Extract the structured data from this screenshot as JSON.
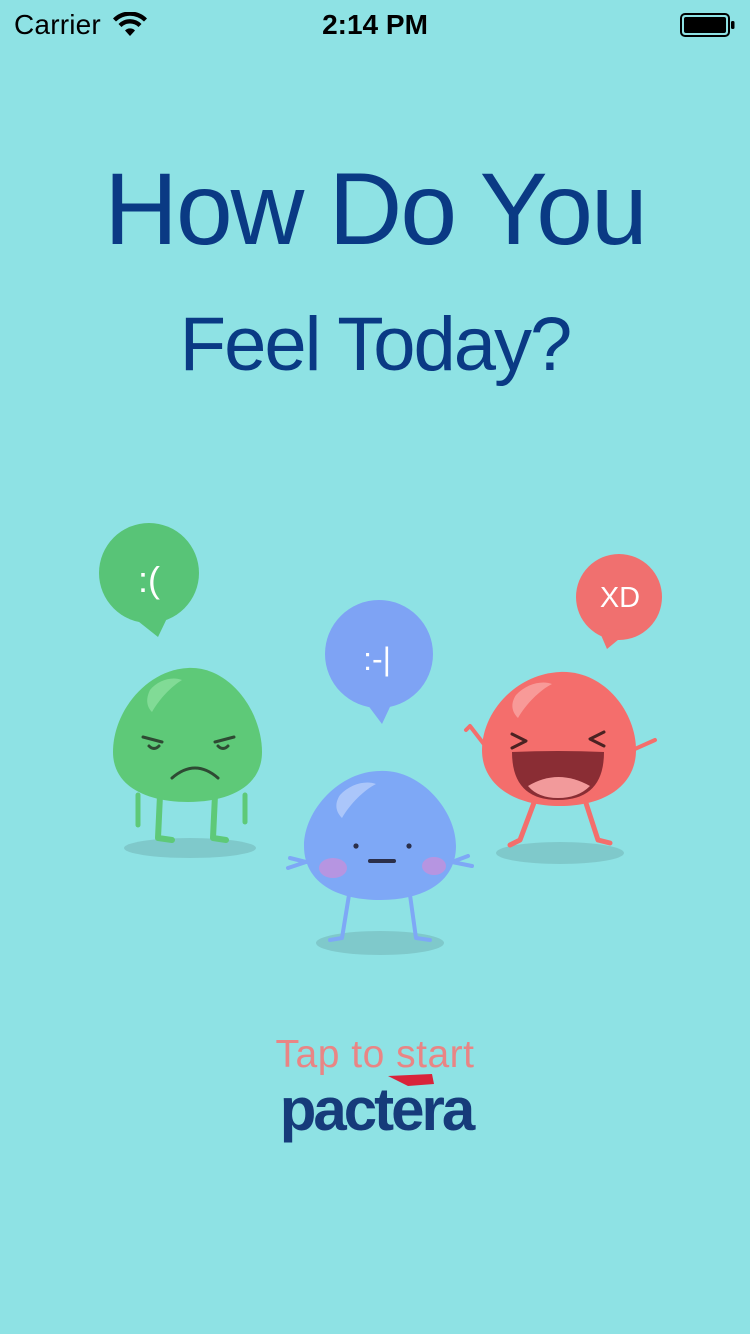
{
  "status_bar": {
    "carrier": "Carrier",
    "time": "2:14 PM",
    "wifi_icon": "wifi-icon",
    "battery_icon": "battery-icon"
  },
  "title": {
    "line1": "How Do You",
    "line2": "Feel Today?"
  },
  "characters": [
    {
      "name": "sad",
      "bubble": ":(",
      "color": "#5ec978",
      "bubble_color": "#58c477"
    },
    {
      "name": "neutral",
      "bubble": ":-|",
      "color": "#7ea8f6",
      "bubble_color": "#7ea3f4"
    },
    {
      "name": "happy",
      "bubble": "XD",
      "color": "#f46e6c",
      "bubble_color": "#f0706f"
    }
  ],
  "footer": {
    "tap_to_start": "Tap to start",
    "logo_text": "pactera"
  },
  "colors": {
    "background": "#8ee2e4",
    "title": "#0a3a84",
    "tap_to_start": "#e98585",
    "logo_text": "#163b7a",
    "logo_accent": "#d9233a"
  }
}
